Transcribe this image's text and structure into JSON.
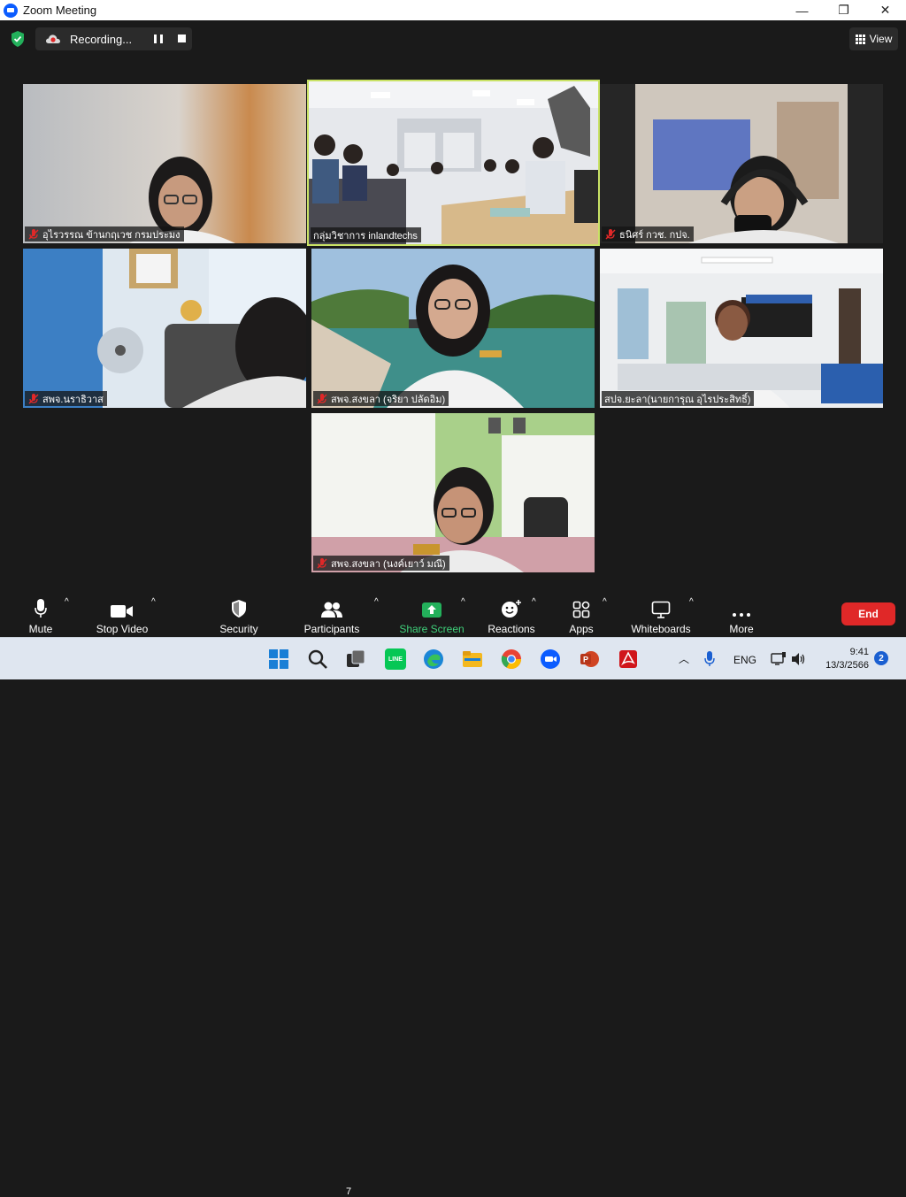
{
  "window": {
    "title": "Zoom Meeting",
    "minimize": "—",
    "maximize": "❐",
    "close": "✕"
  },
  "topbar": {
    "recording_label": "Recording...",
    "view_label": "View"
  },
  "tiles": [
    {
      "name": "อุไรวรรณ ข้านกฤเวช กรมประมง",
      "muted": true
    },
    {
      "name": "กลุ่มวิชาการ inlandtechs",
      "muted": false,
      "active": true
    },
    {
      "name": "ธนิศร์ กวช. กปจ.",
      "muted": true
    },
    {
      "name": "สพจ.นราธิวาส",
      "muted": true
    },
    {
      "name": "สพจ.สงขลา (จริยา ปลัดอิม)",
      "muted": true
    },
    {
      "name": "สปจ.ยะลา(นายการุณ  อุไรประสิทธิ์)",
      "muted": false
    },
    {
      "name": "สพจ.สงขลา (นงค์เยาว์ มณี)",
      "muted": true
    }
  ],
  "toolbar": {
    "mute": "Mute",
    "stop_video": "Stop Video",
    "security": "Security",
    "participants": "Participants",
    "participants_count": "7",
    "share_screen": "Share Screen",
    "reactions": "Reactions",
    "apps": "Apps",
    "whiteboards": "Whiteboards",
    "more": "More",
    "end": "End"
  },
  "taskbar": {
    "language": "ENG",
    "time": "9:41",
    "date": "13/3/2566",
    "notifications": "2",
    "line_label": "LINE"
  },
  "colors": {
    "active_speaker": "#c9e265",
    "share_green": "#3fd07a",
    "end_red": "#e02828",
    "zoom_blue": "#0b5cff"
  }
}
